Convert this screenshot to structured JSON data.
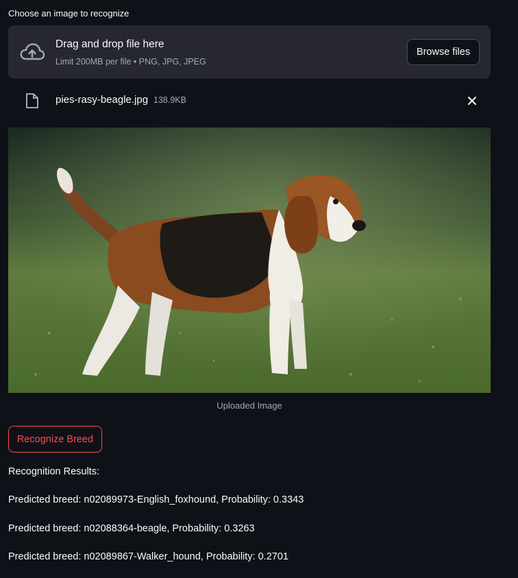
{
  "uploader": {
    "label": "Choose an image to recognize",
    "dropzone_title": "Drag and drop file here",
    "dropzone_limit": "Limit 200MB per file • PNG, JPG, JPEG",
    "browse_label": "Browse files"
  },
  "file": {
    "name": "pies-rasy-beagle.jpg",
    "size": "138.9KB"
  },
  "image": {
    "caption": "Uploaded Image"
  },
  "actions": {
    "recognize_label": "Recognize Breed"
  },
  "results": {
    "title": "Recognition Results:",
    "lines": [
      "Predicted breed: n02089973-English_foxhound, Probability: 0.3343",
      "Predicted breed: n02088364-beagle, Probability: 0.3263",
      "Predicted breed: n02089867-Walker_hound, Probability: 0.2701"
    ]
  },
  "colors": {
    "background": "#0e1117",
    "dropzone": "#262730",
    "accent": "#ff4b4b",
    "muted_text": "#a3a8b8"
  }
}
